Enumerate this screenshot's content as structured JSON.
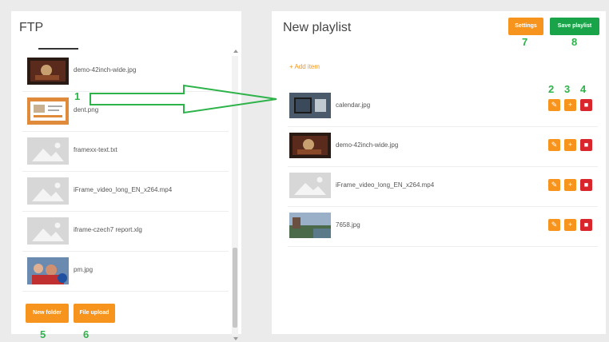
{
  "ftp": {
    "title": "FTP",
    "files": [
      {
        "name": "demo-42inch-wide.jpg",
        "thumb": "photo-dark"
      },
      {
        "name": "dent.png",
        "thumb": "slide-orange"
      },
      {
        "name": "framexx-text.txt",
        "thumb": "placeholder"
      },
      {
        "name": "iFrame_video_long_EN_x264.mp4",
        "thumb": "placeholder"
      },
      {
        "name": "iframe-czech7 report.xlg",
        "thumb": "placeholder"
      },
      {
        "name": "pm.jpg",
        "thumb": "photo-people"
      }
    ],
    "new_folder_label": "New folder",
    "file_upload_label": "File upload"
  },
  "playlist": {
    "title": "New playlist",
    "settings_label": "Settings",
    "save_label": "Save playlist",
    "add_item_label": "+ Add item",
    "items": [
      {
        "name": "calendar.jpg",
        "thumb": "photo-calendar"
      },
      {
        "name": "demo-42inch-wide.jpg",
        "thumb": "photo-dark"
      },
      {
        "name": "iFrame_video_long_EN_x264.mp4",
        "thumb": "placeholder"
      },
      {
        "name": "7658.jpg",
        "thumb": "photo-landscape"
      }
    ]
  },
  "callouts": {
    "n1": "1",
    "n2": "2",
    "n3": "3",
    "n4": "4",
    "n5": "5",
    "n6": "6",
    "n7": "7",
    "n8": "8"
  },
  "colors": {
    "orange": "#f7941d",
    "green": "#19a44a",
    "red": "#d9262c",
    "callout": "#2db34a"
  }
}
